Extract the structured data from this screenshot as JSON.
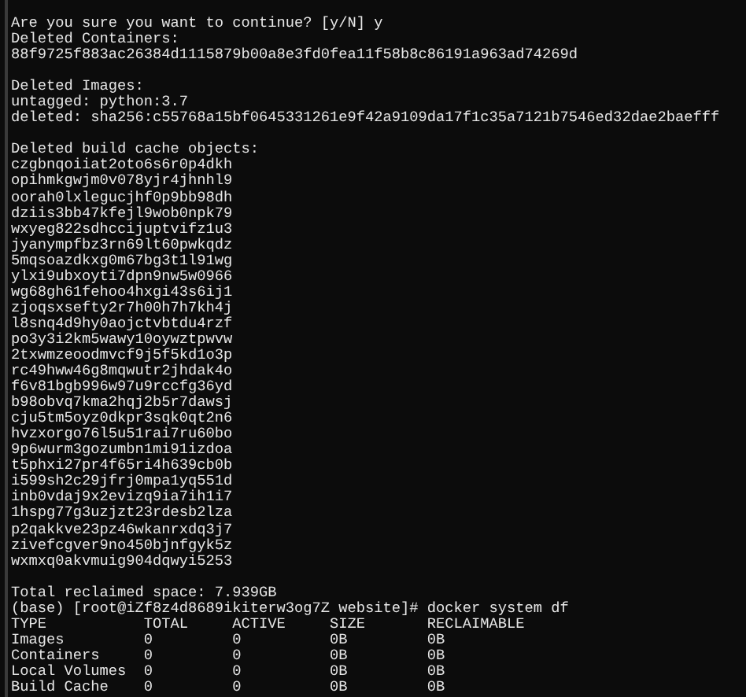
{
  "terminal": {
    "blocks": [
      {
        "lines": [
          "Are you sure you want to continue? [y/N] y",
          "Deleted Containers:",
          "88f9725f883ac26384d1115879b00a8e3fd0fea11f58b8c86191a963ad74269d"
        ]
      },
      {
        "lines": [
          "Deleted Images:",
          "untagged: python:3.7",
          "deleted: sha256:c55768a15bf0645331261e9f42a9109da17f1c35a7121b7546ed32dae2baefff"
        ]
      },
      {
        "lines": [
          "Deleted build cache objects:",
          "czgbnqoiiat2oto6s6r0p4dkh",
          "opihmkgwjm0v078yjr4jhnhl9",
          "oorah0lxlegucjhf0p9bb98dh",
          "dziis3bb47kfejl9wob0npk79",
          "wxyeg822sdhccijuptvifz1u3",
          "jyanympfbz3rn69lt60pwkqdz",
          "5mqsoazdkxg0m67bg3t1l91wg",
          "ylxi9ubxoyti7dpn9nw5w0966",
          "wg68gh61fehoo4hxgi43s6ij1",
          "zjoqsxsefty2r7h00h7h7kh4j",
          "l8snq4d9hy0aojctvbtdu4rzf",
          "po3y3i2km5wawy10oywztpwvw",
          "2txwmzeoodmvcf9j5f5kd1o3p",
          "rc49hww46g8mqwutr2jhdak4o",
          "f6v81bgb996w97u9rccfg36yd",
          "b98obvq7kma2hqj2b5r7dawsj",
          "cju5tm5oyz0dkpr3sqk0qt2n6",
          "hvzxorgo76l5u51rai7ru60bo",
          "9p6wurm3gozumbn1mi91izdoa",
          "t5phxi27pr4f65ri4h639cb0b",
          "i599sh2c29jfrj0mpa1yq551d",
          "inb0vdaj9x2evizq9ia7ih1i7",
          "1hspg77g3uzjzt23rdesb2lza",
          "p2qakkve23pz46wkanrxdq3j7",
          "zivefcgver9no450bjnfgyk5z",
          "wxmxq0akvmuig904dqwyi5253"
        ]
      },
      {
        "lines": [
          "Total reclaimed space: 7.939GB",
          "(base) [root@iZf8z4d8689ikiterw3og7Z website]# docker system df"
        ]
      }
    ],
    "table": {
      "columns": [
        "TYPE",
        "TOTAL",
        "ACTIVE",
        "SIZE",
        "RECLAIMABLE"
      ],
      "rows": [
        [
          "Images",
          "0",
          "0",
          "0B",
          "0B"
        ],
        [
          "Containers",
          "0",
          "0",
          "0B",
          "0B"
        ],
        [
          "Local Volumes",
          "0",
          "0",
          "0B",
          "0B"
        ],
        [
          "Build Cache",
          "0",
          "0",
          "0B",
          "0B"
        ]
      ]
    }
  }
}
